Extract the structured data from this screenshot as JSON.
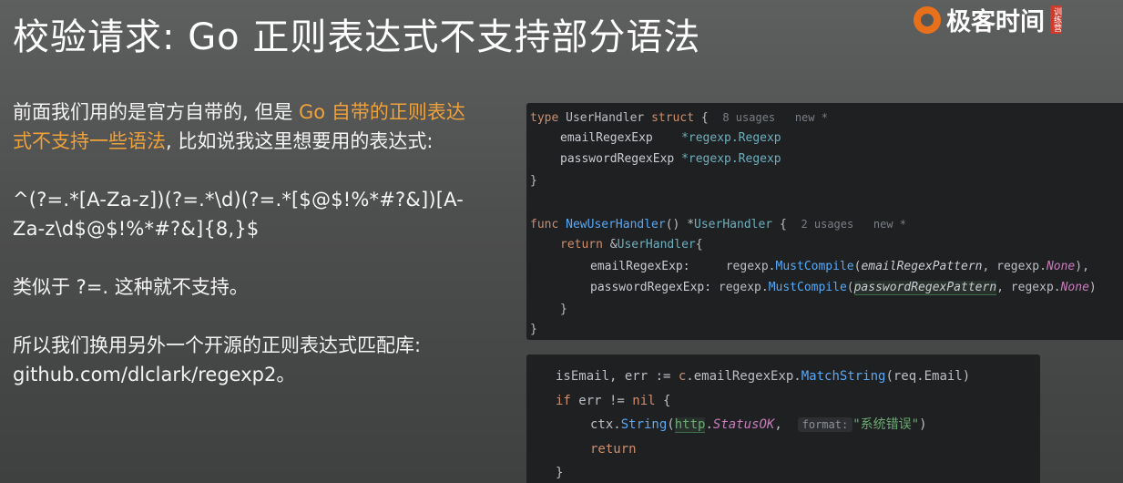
{
  "slide": {
    "title": "校验请求: Go 正则表达式不支持部分语法",
    "logo_text": "极客时间",
    "logo_badge": "训练营"
  },
  "body": {
    "p1_a": "前面我们用的是官方自带的, 但是 ",
    "p1_hl": "Go 自带的正则表达式不支持一些语法",
    "p1_b": ", 比如说我这里想要用的表达式:",
    "p2": "^(?=.*[A-Za-z])(?=.*\\d)(?=.*[$@$!%*#?&])[A-Za-z\\d$@$!%*#?&]{8,}$",
    "p3": "类似于 ?=. 这种就不支持。",
    "p4": "所以我们换用另外一个开源的正则表达式匹配库: github.com/dlclark/regexp2。"
  },
  "code_top": {
    "l1_kw": "type",
    "l1_name": "UserHandler",
    "l1_kw2": "struct",
    "l1_brace": " {",
    "l1_hint": "8 usages   new *",
    "l2_field": "emailRegexExp",
    "l2_type": "*regexp.Regexp",
    "l3_field": "passwordRegexExp",
    "l3_type": "*regexp.Regexp",
    "l4": "}",
    "l5_kw": "func",
    "l5_fn": "NewUserHandler",
    "l5_paren": "() *",
    "l5_type": "UserHandler",
    "l5_brace": " {",
    "l5_hint": "2 usages   new *",
    "l6_kw": "return",
    "l6_amp": " &",
    "l6_type": "UserHandler",
    "l6_brace": "{",
    "l7_field": "emailRegexExp:",
    "l7_pkg": "regexp.",
    "l7_fn": "MustCompile",
    "l7_open": "(",
    "l7_param": "emailRegexPattern",
    "l7_mid": ", regexp.",
    "l7_const": "None",
    "l7_close": "),",
    "l8_field": "passwordRegexExp:",
    "l8_pkg": "regexp.",
    "l8_fn": "MustCompile",
    "l8_open": "(",
    "l8_param": "passwordRegexPattern",
    "l8_mid": ", regexp.",
    "l8_const": "None",
    "l8_close": ")",
    "l9": "}",
    "l10": "}"
  },
  "code_bottom": {
    "l1_a": "isEmail, err := ",
    "l1_c": "c",
    "l1_b": ".emailRegexExp.",
    "l1_fn": "MatchString",
    "l1_args": "(req.Email)",
    "l2_kw": "if",
    "l2_mid": " err != ",
    "l2_kw2": "nil",
    "l2_brace": " {",
    "l3_a": "ctx.",
    "l3_fn": "String",
    "l3_open": "(",
    "l3_pkg": "http",
    "l3_dot": ".",
    "l3_const": "StatusOK",
    "l3_comma": ", ",
    "l3_inlay": "format:",
    "l3_str": "\"系统错误\"",
    "l3_close": ")",
    "l4_kw": "return",
    "l5": "}"
  }
}
